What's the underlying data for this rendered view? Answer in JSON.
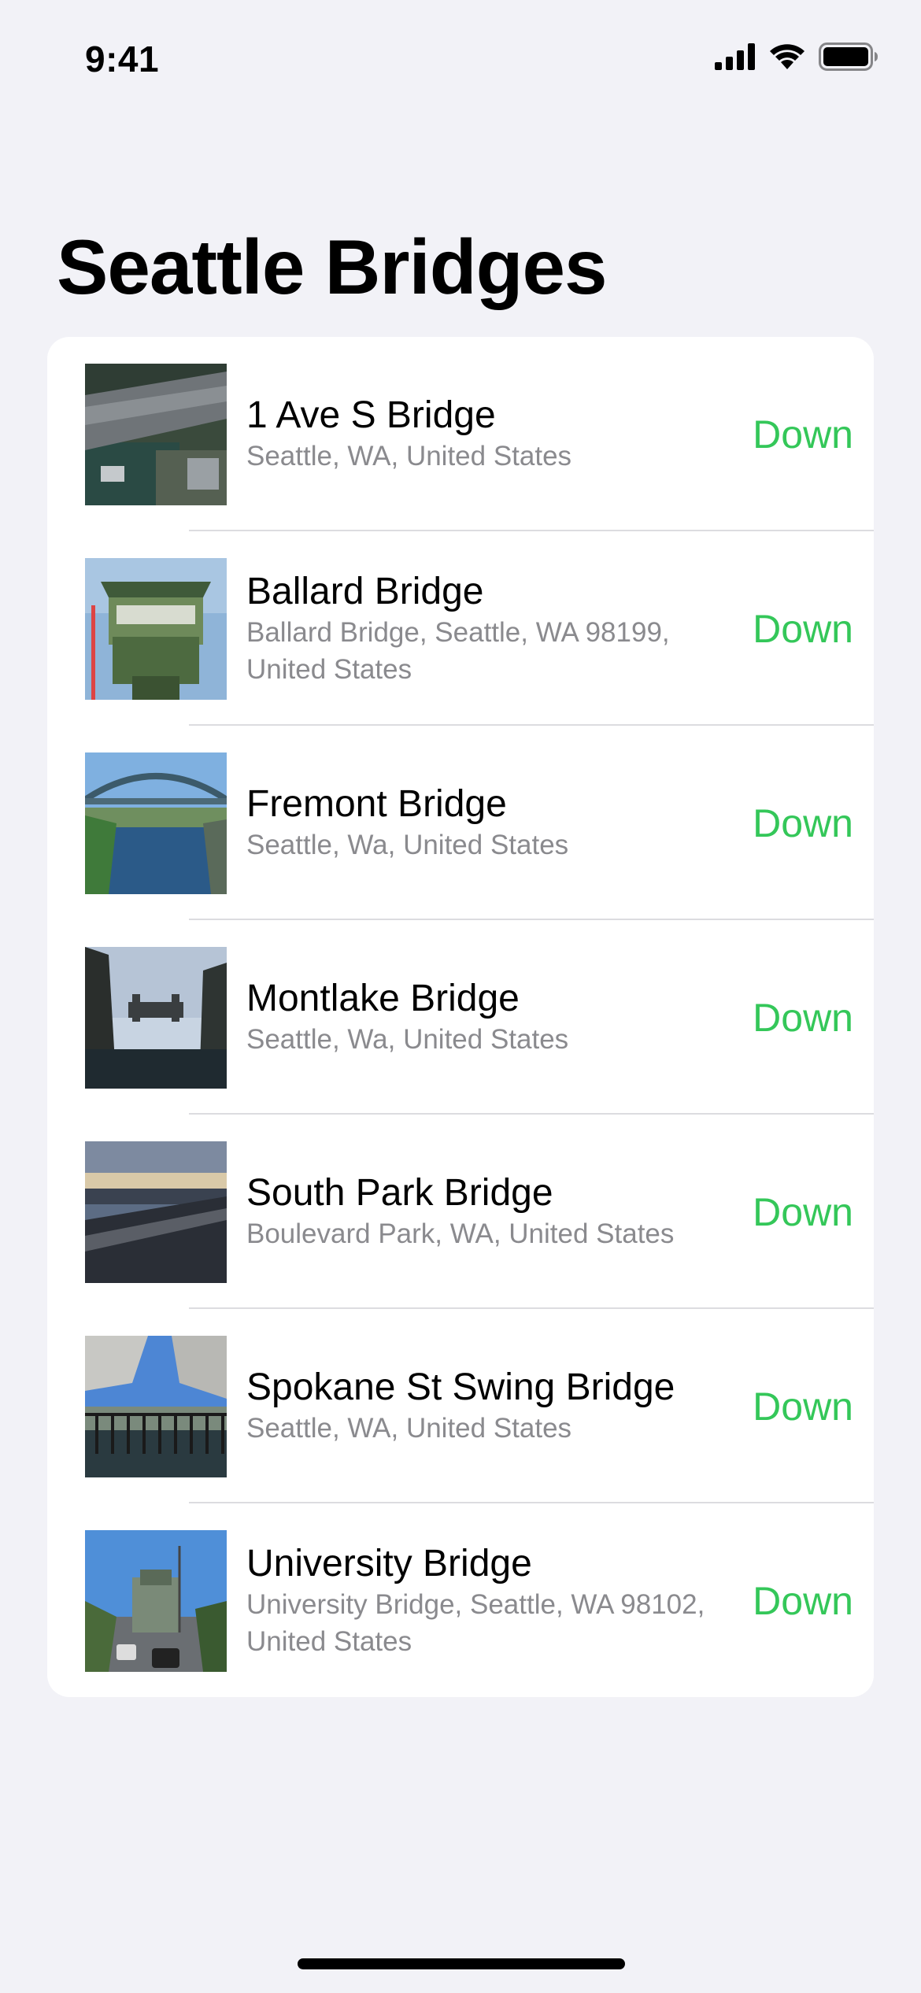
{
  "status_bar": {
    "time": "9:41"
  },
  "header": {
    "title": "Seattle Bridges"
  },
  "colors": {
    "status_down": "#34c759",
    "secondary_text": "#8a8a8e",
    "background": "#f2f2f7"
  },
  "bridges": [
    {
      "name": "1 Ave S Bridge",
      "address": "Seattle, WA, United States",
      "status": "Down",
      "thumbnail": "aerial-bridge-photo"
    },
    {
      "name": "Ballard Bridge",
      "address": "Ballard Bridge, Seattle, WA 98199, United States",
      "status": "Down",
      "thumbnail": "bridge-tower-photo"
    },
    {
      "name": "Fremont Bridge",
      "address": "Seattle, Wa, United States",
      "status": "Down",
      "thumbnail": "canal-bridge-photo"
    },
    {
      "name": "Montlake Bridge",
      "address": "Seattle, Wa, United States",
      "status": "Down",
      "thumbnail": "montlake-bridge-photo"
    },
    {
      "name": "South Park Bridge",
      "address": "Boulevard Park, WA, United States",
      "status": "Down",
      "thumbnail": "sunset-bridge-photo"
    },
    {
      "name": "Spokane St Swing Bridge",
      "address": "Seattle, WA, United States",
      "status": "Down",
      "thumbnail": "overpass-bridge-photo"
    },
    {
      "name": "University Bridge",
      "address": "University Bridge, Seattle, WA 98102, United States",
      "status": "Down",
      "thumbnail": "street-bridge-photo"
    }
  ]
}
